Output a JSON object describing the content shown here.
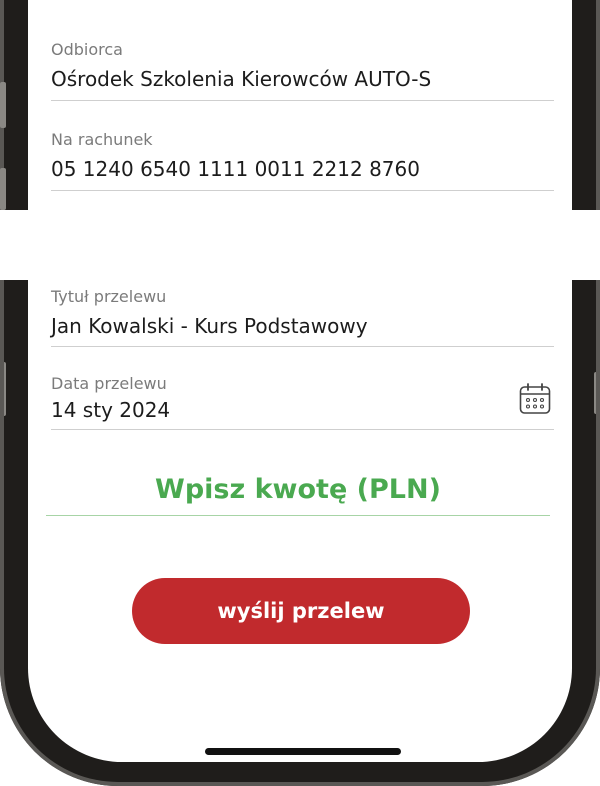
{
  "recipient": {
    "label": "Odbiorca",
    "value": "Ośrodek Szkolenia Kierowców AUTO-S"
  },
  "account": {
    "label": "Na rachunek",
    "value": "05 1240 6540 1111 0011 2212 8760"
  },
  "title": {
    "label": "Tytuł przelewu",
    "value": "Jan Kowalski - Kurs Podstawowy"
  },
  "date": {
    "label": "Data przelewu",
    "value": "14 sty 2024",
    "icon": "calendar-icon"
  },
  "amount": {
    "placeholder": "Wpisz kwotę (PLN)"
  },
  "send_button": {
    "label": "wyślij przelew"
  },
  "colors": {
    "accent_green": "#4aa950",
    "button_red": "#c12a2d",
    "frame": "#1f1d1b"
  }
}
